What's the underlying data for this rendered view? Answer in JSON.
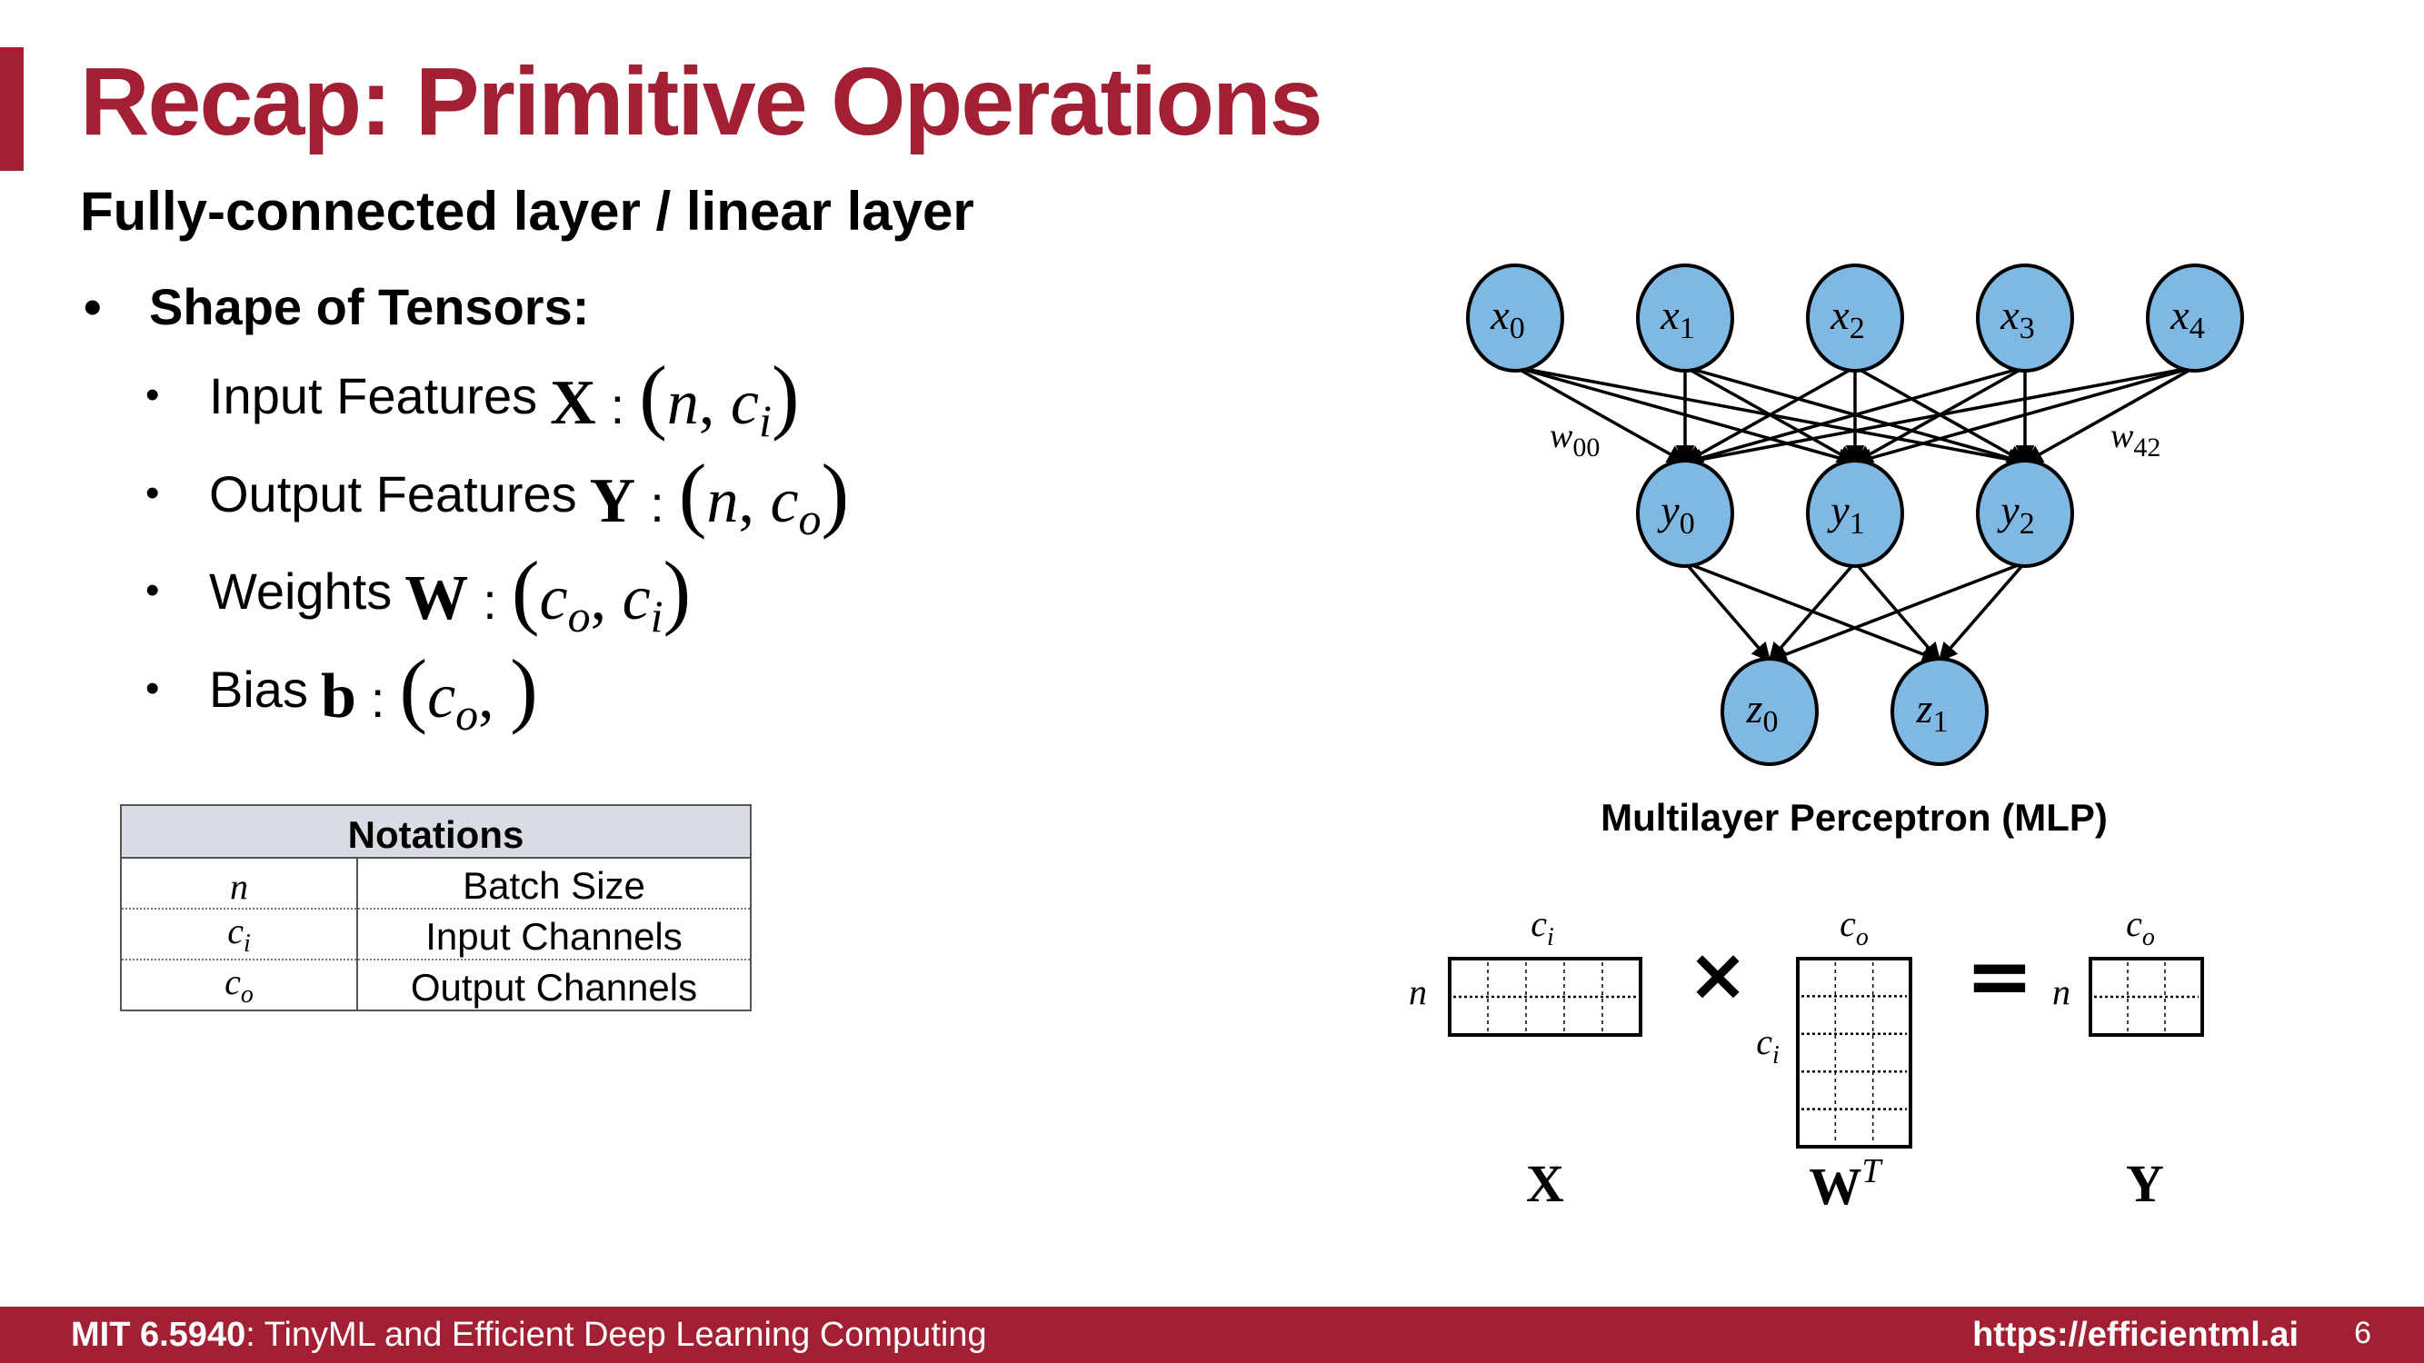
{
  "title": "Recap: Primitive Operations",
  "subtitle": "Fully-connected layer / linear layer",
  "bullet_main": "Shape of Tensors:",
  "bullets": [
    {
      "label": "Input Features",
      "symbol": "X",
      "open": "(",
      "a": "n",
      "sep": ",",
      "b": "c",
      "b_sub": "i",
      "close": ")"
    },
    {
      "label": "Output Features",
      "symbol": "Y",
      "open": "(",
      "a": "n",
      "sep": ",",
      "b": "c",
      "b_sub": "o",
      "close": ")"
    },
    {
      "label": "Weights",
      "symbol": "W",
      "open": "(",
      "a": "c",
      "a_sub": "o",
      "sep": ",",
      "b": "c",
      "b_sub": "i",
      "close": ")"
    },
    {
      "label": "Bias",
      "symbol": "b",
      "open": "(",
      "a": "c",
      "a_sub": "o",
      "sep": ",",
      "close": ")"
    }
  ],
  "colon": ":",
  "notations": {
    "header": "Notations",
    "rows": [
      {
        "symbol": "n",
        "sub": "",
        "meaning": "Batch Size"
      },
      {
        "symbol": "c",
        "sub": "i",
        "meaning": "Input Channels"
      },
      {
        "symbol": "c",
        "sub": "o",
        "meaning": "Output Channels"
      }
    ]
  },
  "mlp": {
    "caption": "Multilayer Perceptron (MLP)",
    "layers": [
      {
        "var": "x",
        "subs": [
          "0",
          "1",
          "2",
          "3",
          "4"
        ]
      },
      {
        "var": "y",
        "subs": [
          "0",
          "1",
          "2"
        ]
      },
      {
        "var": "z",
        "subs": [
          "0",
          "1"
        ]
      }
    ],
    "weight_labels": [
      {
        "var": "w",
        "sub": "00"
      },
      {
        "var": "w",
        "sub": "42"
      }
    ],
    "node_color": "#7fb8e2"
  },
  "matmul": {
    "x": {
      "name": "X",
      "top": "c",
      "top_sub": "i",
      "side": "n"
    },
    "times": "×",
    "w": {
      "name": "W",
      "sup": "T",
      "top": "c",
      "top_sub": "o",
      "side": "c",
      "side_sub": "i"
    },
    "equals": "=",
    "y": {
      "name": "Y",
      "top": "c",
      "top_sub": "o",
      "side": "n"
    }
  },
  "footer": {
    "course": "MIT 6.5940",
    "course_title": ": TinyML and Efficient Deep Learning Computing",
    "url": "https://efficientml.ai",
    "page": "6"
  },
  "colors": {
    "brand": "#a31f34",
    "table_header": "#d9dde3"
  }
}
